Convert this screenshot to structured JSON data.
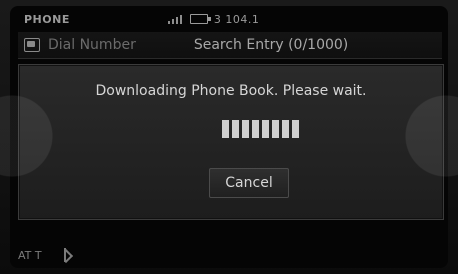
{
  "status": {
    "title": "PHONE",
    "frequency": "3  104.1"
  },
  "topbar": {
    "dial_label": "Dial Number",
    "search_label": "Search Entry (0/1000)"
  },
  "dialog": {
    "message": "Downloading Phone Book. Please wait.",
    "progress_segments_filled": 8,
    "progress_segments_total": 8,
    "cancel_label": "Cancel"
  },
  "bottom": {
    "left_text": "AT T"
  }
}
